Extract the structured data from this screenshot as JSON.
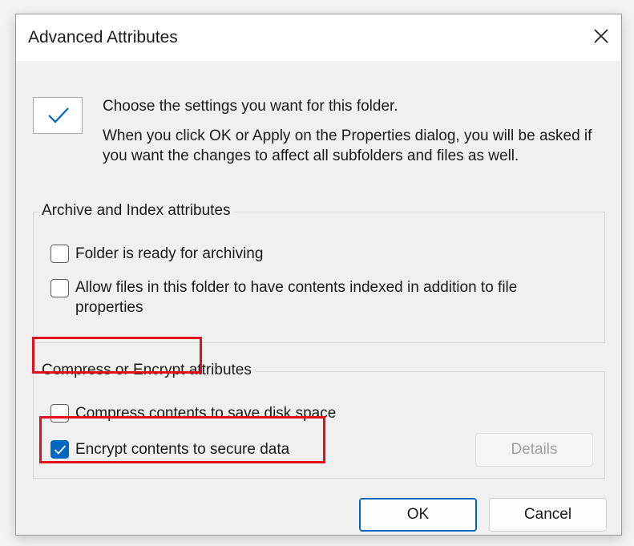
{
  "dialog": {
    "title": "Advanced Attributes",
    "intro_heading": "Choose the settings you want for this folder.",
    "intro_body": "When you click OK or Apply on the Properties dialog, you will be asked if you want the changes to affect all subfolders and files as well."
  },
  "archive_group": {
    "label": "Archive and Index attributes",
    "options": [
      {
        "label": "Folder is ready for archiving",
        "checked": false
      },
      {
        "label": "Allow files in this folder to have contents indexed in addition to file properties",
        "checked": false
      }
    ]
  },
  "compress_group": {
    "label": "Compress or Encrypt attributes",
    "options": [
      {
        "label": "Compress contents to save disk space",
        "checked": false
      },
      {
        "label": "Encrypt contents to secure data",
        "checked": true
      }
    ],
    "details_label": "Details",
    "details_enabled": false
  },
  "footer": {
    "ok_label": "OK",
    "cancel_label": "Cancel"
  },
  "colors": {
    "accent": "#0067c0",
    "highlight": "#e3101b"
  },
  "icons": [
    "close-icon",
    "checkmark-icon"
  ]
}
